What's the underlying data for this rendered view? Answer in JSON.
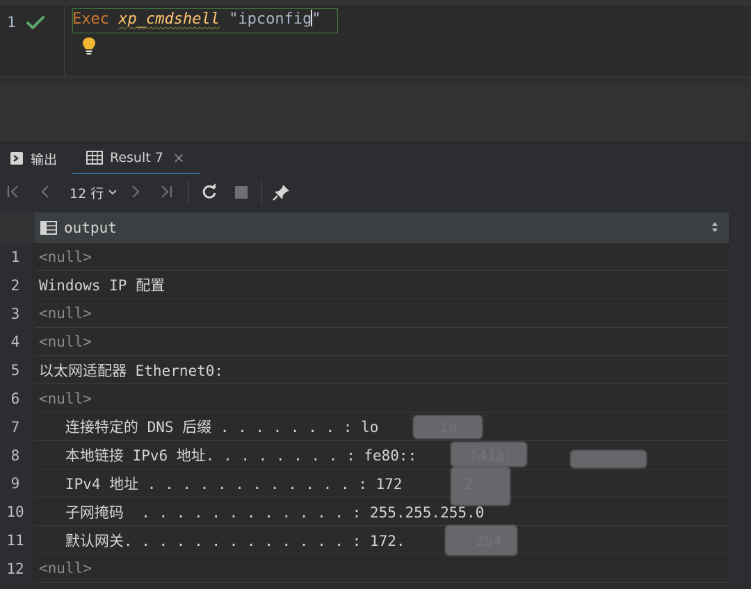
{
  "editor": {
    "line_number": "1",
    "keyword": "Exec",
    "procedure": "xp_cmdshell",
    "string_before_caret": "\"ipconfig",
    "string_after_caret": "\""
  },
  "tabs": [
    {
      "label": "输出",
      "icon": "console-icon"
    },
    {
      "label": "Result 7",
      "icon": "table-icon",
      "close": "×"
    }
  ],
  "toolbar": {
    "rows_label": "12 行",
    "rows_chevron": "⌄"
  },
  "grid": {
    "column": "output",
    "sort_icon": "⇕",
    "rows": [
      {
        "n": "1",
        "text": "<null>",
        "null": true
      },
      {
        "n": "2",
        "text": "Windows IP 配置"
      },
      {
        "n": "3",
        "text": "<null>",
        "null": true
      },
      {
        "n": "4",
        "text": "<null>",
        "null": true
      },
      {
        "n": "5",
        "text": "以太网适配器 Ethernet0:"
      },
      {
        "n": "6",
        "text": "<null>",
        "null": true
      },
      {
        "n": "7",
        "text": "   连接特定的 DNS 后缀 . . . . . . . : lo       in"
      },
      {
        "n": "8",
        "text": "   本地链接 IPv6 地址. . . . . . . . : fe80::      f41a:"
      },
      {
        "n": "9",
        "text": "   IPv4 地址 . . . . . . . . . . . . : 172      .2"
      },
      {
        "n": "10",
        "text": "   子网掩码  . . . . . . . . . . . . : 255.255.255.0"
      },
      {
        "n": "11",
        "text": "   默认网关. . . . . . . . . . . . . : 172.        254"
      },
      {
        "n": "12",
        "text": "<null>",
        "null": true
      }
    ]
  },
  "colors": {
    "keyword": "#cc7832",
    "procedure": "#ffc66d",
    "accent": "#4a88c7",
    "check": "#59a869"
  }
}
